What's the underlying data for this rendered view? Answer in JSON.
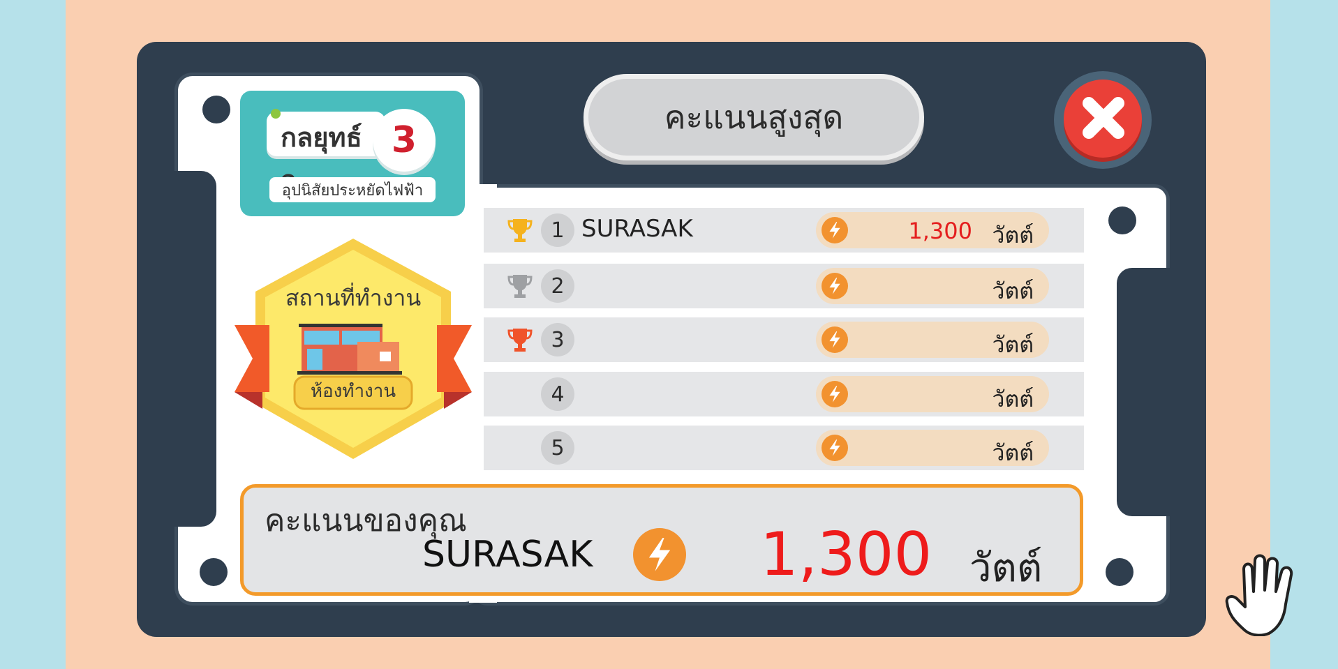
{
  "logo": {
    "title": "กลยุทธ์ อ.",
    "number": "3",
    "subtitle": "อุปนิสัยประหยัดไฟฟ้า"
  },
  "badge": {
    "title": "สถานที่ทำงาน",
    "subtitle": "ห้องทำงาน"
  },
  "header": {
    "title": "คะแนนสูงสุด"
  },
  "unit": "วัตต์",
  "leaderboard": [
    {
      "rank": "1",
      "name": "SURASAK",
      "score": "1,300",
      "trophy": "gold-trophy-icon",
      "trophy_color": "#f5b21d"
    },
    {
      "rank": "2",
      "name": "",
      "score": "",
      "trophy": "silver-trophy-icon",
      "trophy_color": "#9ea0a3"
    },
    {
      "rank": "3",
      "name": "",
      "score": "",
      "trophy": "bronze-trophy-icon",
      "trophy_color": "#f0532a"
    },
    {
      "rank": "4",
      "name": "",
      "score": "",
      "trophy": "",
      "trophy_color": ""
    },
    {
      "rank": "5",
      "name": "",
      "score": "",
      "trophy": "",
      "trophy_color": ""
    }
  ],
  "your_score": {
    "label": "คะแนนของคุณ",
    "name": "SURASAK",
    "score": "1,300",
    "unit": "วัตต์"
  },
  "icons": {
    "close": "close-icon",
    "bolt": "lightning-bolt-icon",
    "hand": "hand-cursor-icon"
  },
  "colors": {
    "panel": "#2f3e4e",
    "accent": "#f39a2a",
    "score_red": "#e41d1d",
    "teal": "#49bdbd",
    "close_red": "#ea4038"
  }
}
